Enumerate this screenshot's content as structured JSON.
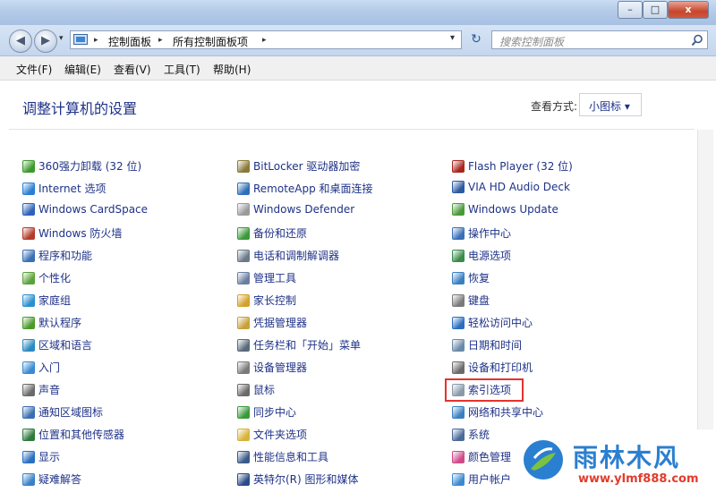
{
  "window": {
    "controls": {
      "minimize": "–",
      "maximize": "□",
      "close": "x"
    }
  },
  "address": {
    "crumbs": [
      "控制面板",
      "所有控制面板项"
    ],
    "sep": "▸",
    "nav_back": "◀",
    "nav_forward": "▶",
    "refresh": "↻"
  },
  "search": {
    "placeholder": "搜索控制面板"
  },
  "menu": [
    "文件(F)",
    "编辑(E)",
    "查看(V)",
    "工具(T)",
    "帮助(H)"
  ],
  "main": {
    "title": "调整计算机的设置",
    "view_label": "查看方式:",
    "view_value": "小图标 ▾"
  },
  "columns": [
    [
      {
        "label": "360强力卸载 (32 位)",
        "icon": "uninstall-icon",
        "color": "#3b9a2a"
      },
      {
        "label": "Internet 选项",
        "icon": "internet-options-icon",
        "color": "#2a7fd4"
      },
      {
        "label": "Windows CardSpace",
        "icon": "cardspace-icon",
        "color": "#2e62b8"
      },
      {
        "label": "Windows 防火墙",
        "icon": "firewall-icon",
        "color": "#b43a2a"
      },
      {
        "label": "程序和功能",
        "icon": "programs-icon",
        "color": "#3a6fb4"
      },
      {
        "label": "个性化",
        "icon": "personalization-icon",
        "color": "#5aa23a"
      },
      {
        "label": "家庭组",
        "icon": "homegroup-icon",
        "color": "#2a8fd0"
      },
      {
        "label": "默认程序",
        "icon": "default-programs-icon",
        "color": "#4a9a2a"
      },
      {
        "label": "区域和语言",
        "icon": "region-language-icon",
        "color": "#2a8abf"
      },
      {
        "label": "入门",
        "icon": "getting-started-icon",
        "color": "#3a8ad4"
      },
      {
        "label": "声音",
        "icon": "sound-icon",
        "color": "#6a6a6a"
      },
      {
        "label": "通知区域图标",
        "icon": "notification-icon",
        "color": "#3b6fb0"
      },
      {
        "label": "位置和其他传感器",
        "icon": "location-sensor-icon",
        "color": "#2e7a3a"
      },
      {
        "label": "显示",
        "icon": "display-icon",
        "color": "#2a6fc0"
      },
      {
        "label": "疑难解答",
        "icon": "troubleshooting-icon",
        "color": "#3a80c8"
      }
    ],
    [
      {
        "label": "BitLocker 驱动器加密",
        "icon": "bitlocker-icon",
        "color": "#8a7a3a"
      },
      {
        "label": "RemoteApp 和桌面连接",
        "icon": "remoteapp-icon",
        "color": "#2f6fb8"
      },
      {
        "label": "Windows Defender",
        "icon": "defender-icon",
        "color": "#9a9a9a"
      },
      {
        "label": "备份和还原",
        "icon": "backup-icon",
        "color": "#3a9a3a"
      },
      {
        "label": "电话和调制解调器",
        "icon": "phone-modem-icon",
        "color": "#6a7a8a"
      },
      {
        "label": "管理工具",
        "icon": "admin-tools-icon",
        "color": "#6a7fa0"
      },
      {
        "label": "家长控制",
        "icon": "parental-control-icon",
        "color": "#d4a12a"
      },
      {
        "label": "凭据管理器",
        "icon": "credential-icon",
        "color": "#c8a03a"
      },
      {
        "label": "任务栏和「开始」菜单",
        "icon": "taskbar-icon",
        "color": "#5a6a7a"
      },
      {
        "label": "设备管理器",
        "icon": "device-manager-icon",
        "color": "#7a7a7a"
      },
      {
        "label": "鼠标",
        "icon": "mouse-icon",
        "color": "#6a6a6a"
      },
      {
        "label": "同步中心",
        "icon": "sync-icon",
        "color": "#3a9a3a"
      },
      {
        "label": "文件夹选项",
        "icon": "folder-options-icon",
        "color": "#d8b23a"
      },
      {
        "label": "性能信息和工具",
        "icon": "performance-icon",
        "color": "#3a5a8a"
      },
      {
        "label": "英特尔(R) 图形和媒体",
        "icon": "intel-graphics-icon",
        "color": "#2a4a8a"
      }
    ],
    [
      {
        "label": "Flash Player (32 位)",
        "icon": "flash-icon",
        "color": "#a8261e"
      },
      {
        "label": "VIA HD Audio Deck",
        "icon": "via-audio-icon",
        "color": "#2a5aa0"
      },
      {
        "label": "Windows Update",
        "icon": "windows-update-icon",
        "color": "#4a9a3a"
      },
      {
        "label": "操作中心",
        "icon": "action-center-icon",
        "color": "#3a6fb8"
      },
      {
        "label": "电源选项",
        "icon": "power-icon",
        "color": "#3a8a4a"
      },
      {
        "label": "恢复",
        "icon": "recovery-icon",
        "color": "#3a7fc0"
      },
      {
        "label": "键盘",
        "icon": "keyboard-icon",
        "color": "#7a7a7a"
      },
      {
        "label": "轻松访问中心",
        "icon": "ease-of-access-icon",
        "color": "#2a6fc0"
      },
      {
        "label": "日期和时间",
        "icon": "date-time-icon",
        "color": "#6a8aa8"
      },
      {
        "label": "设备和打印机",
        "icon": "devices-printers-icon",
        "color": "#6a6a6a"
      },
      {
        "label": "索引选项",
        "icon": "indexing-icon",
        "color": "#8a9aaa"
      },
      {
        "label": "网络和共享中心",
        "icon": "network-sharing-icon",
        "color": "#3a7fc0"
      },
      {
        "label": "系统",
        "icon": "system-icon",
        "color": "#4a6a9a"
      },
      {
        "label": "颜色管理",
        "icon": "color-management-icon",
        "color": "#d04a8a"
      },
      {
        "label": "用户帐户",
        "icon": "user-accounts-icon",
        "color": "#3a8ad0"
      }
    ]
  ],
  "highlight_item": "索引选项",
  "watermark": {
    "name": "雨林木风",
    "url": "www.ylmf888.com"
  }
}
